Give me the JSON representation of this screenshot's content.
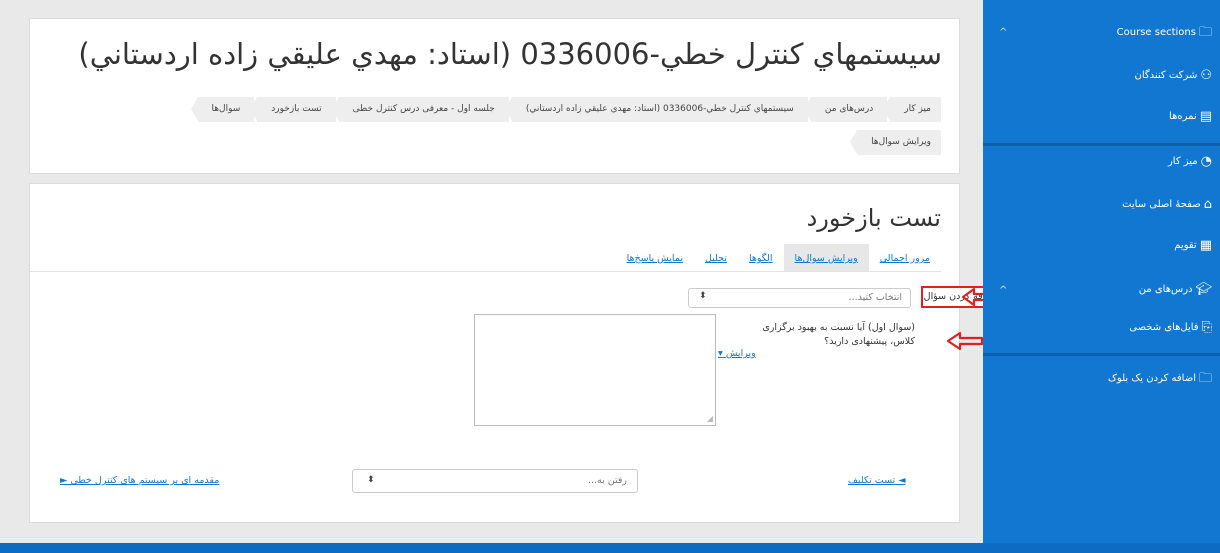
{
  "header": {
    "course_title": "سيستمهاي كنترل خطي-0336006 (استاد: مهدي عليقي زاده اردستاني)",
    "breadcrumb": [
      "میز کار",
      "درس‌های من",
      "سيستمهاي كنترل خطي-0336006 (استاد: مهدي عليقي زاده اردستاني)",
      "جلسه اول - معرفی درس کنترل خطی",
      "تست بازخورد",
      "سوال‌ها",
      "ویرایش سوال‌ها"
    ]
  },
  "quiz": {
    "title": "تست بازخورد",
    "tabs": [
      "مرور اجمالی",
      "ویرایش سوال‌ها",
      "الگوها",
      "تحلیل",
      "نمایش پاسخ‌ها"
    ],
    "active_tab": "ویرایش سوال‌ها",
    "add_question_label": "اضافه کردن سؤال",
    "add_question_placeholder": "انتخاب کنید...",
    "question_text": "(سوال اول) آیا نسبت به بهبود برگزاری کلاس، پیشنهادی دارید؟",
    "edit_label": "ویرایش",
    "prev_link": "◄ تست تکلیف",
    "jump_placeholder": "رفتن به...",
    "next_link": "مقدمه ای بر سیستم های کنترل خطی ►"
  },
  "sidebar": {
    "items": [
      {
        "label": "Course sections",
        "icon": "folder-icon"
      },
      {
        "label": "شرکت کنندگان",
        "icon": "users-icon"
      },
      {
        "label": "نمره‌ها",
        "icon": "grades-icon"
      },
      {
        "label": "میز کار",
        "icon": "dashboard-icon"
      },
      {
        "label": "صفحهٔ اصلی سایت",
        "icon": "home-icon"
      },
      {
        "label": "تقویم",
        "icon": "calendar-icon"
      },
      {
        "label": "درس‌های من",
        "icon": "graduation-cap-icon"
      },
      {
        "label": "فایل‌های شخصی",
        "icon": "files-icon"
      },
      {
        "label": "اضافه کردن یک بلوک",
        "icon": "add-block-icon"
      }
    ]
  },
  "colors": {
    "sidebar_bg": "#1177d1",
    "link": "#1177d1",
    "highlight": "#e02020"
  }
}
